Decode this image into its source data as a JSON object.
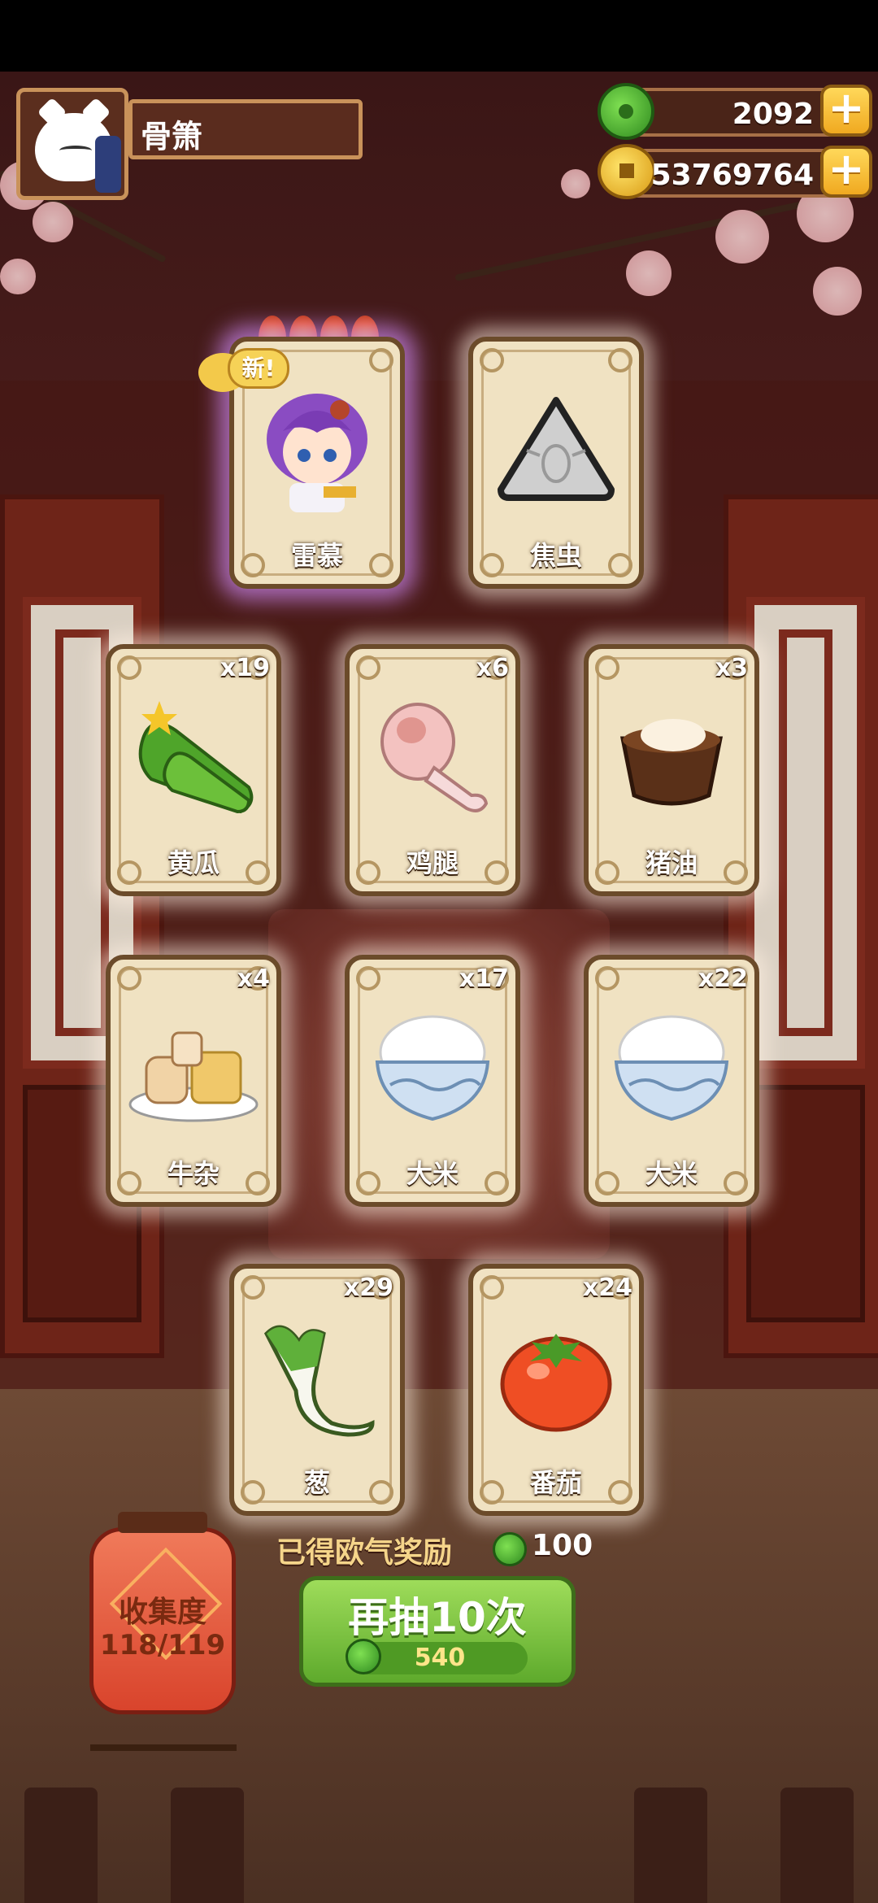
{
  "player": {
    "name": "骨箫"
  },
  "currency": {
    "jade": "2092",
    "coins": "53769764"
  },
  "cards": [
    {
      "label": "雷慕",
      "count": "",
      "art": "purple-hair-girl-icon",
      "rarity": "purple",
      "is_new": true,
      "new_label": "新!",
      "flames": 4
    },
    {
      "label": "焦虫",
      "count": "",
      "art": "triangle-bug-icon"
    },
    {
      "label": "黄瓜",
      "count": "x19",
      "art": "cucumber-icon"
    },
    {
      "label": "鸡腿",
      "count": "x6",
      "art": "chicken-leg-icon"
    },
    {
      "label": "猪油",
      "count": "x3",
      "art": "lard-bowl-icon"
    },
    {
      "label": "牛杂",
      "count": "x4",
      "art": "beef-offal-plate-icon"
    },
    {
      "label": "大米",
      "count": "x17",
      "art": "rice-bowl-icon"
    },
    {
      "label": "大米",
      "count": "x22",
      "art": "rice-bowl-icon"
    },
    {
      "label": "葱",
      "count": "x29",
      "art": "scallion-icon"
    },
    {
      "label": "番茄",
      "count": "x24",
      "art": "tomato-icon"
    }
  ],
  "reward": {
    "label": "已得欧气奖励",
    "value": "100"
  },
  "draw_button": {
    "label": "再抽10次",
    "cost": "540"
  },
  "collection": {
    "label": "收集度",
    "value": "118/119"
  },
  "colors": {
    "accent_green": "#6bbd35",
    "gold": "#f0b020",
    "card_bg": "#f0e2c2"
  }
}
